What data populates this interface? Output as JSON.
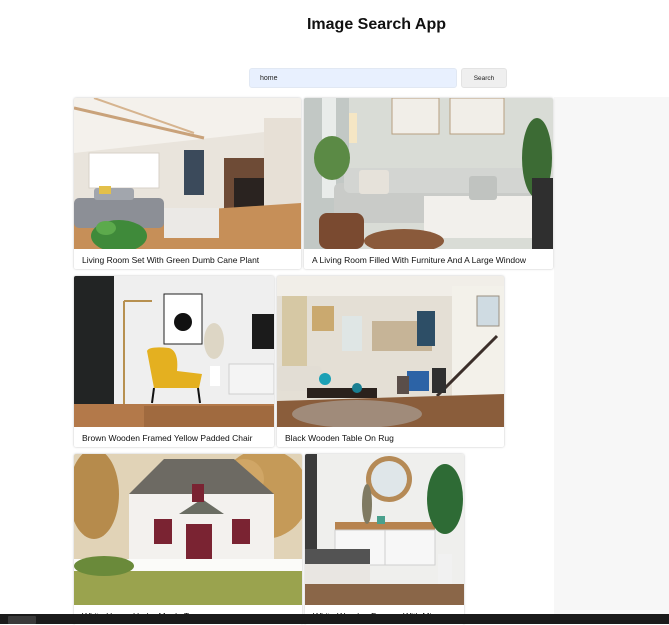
{
  "header": {
    "title": "Image Search App"
  },
  "search": {
    "value": "home",
    "button_label": "Search"
  },
  "results": [
    {
      "caption": "Living Room Set With Green Dumb Cane Plant"
    },
    {
      "caption": "A Living Room Filled With Furniture And A Large Window"
    },
    {
      "caption": "Brown Wooden Framed Yellow Padded Chair"
    },
    {
      "caption": "Black Wooden Table On Rug"
    },
    {
      "caption": "White House Under Maple Tree"
    },
    {
      "caption": "White Wooden Dresser With Mirror"
    }
  ]
}
